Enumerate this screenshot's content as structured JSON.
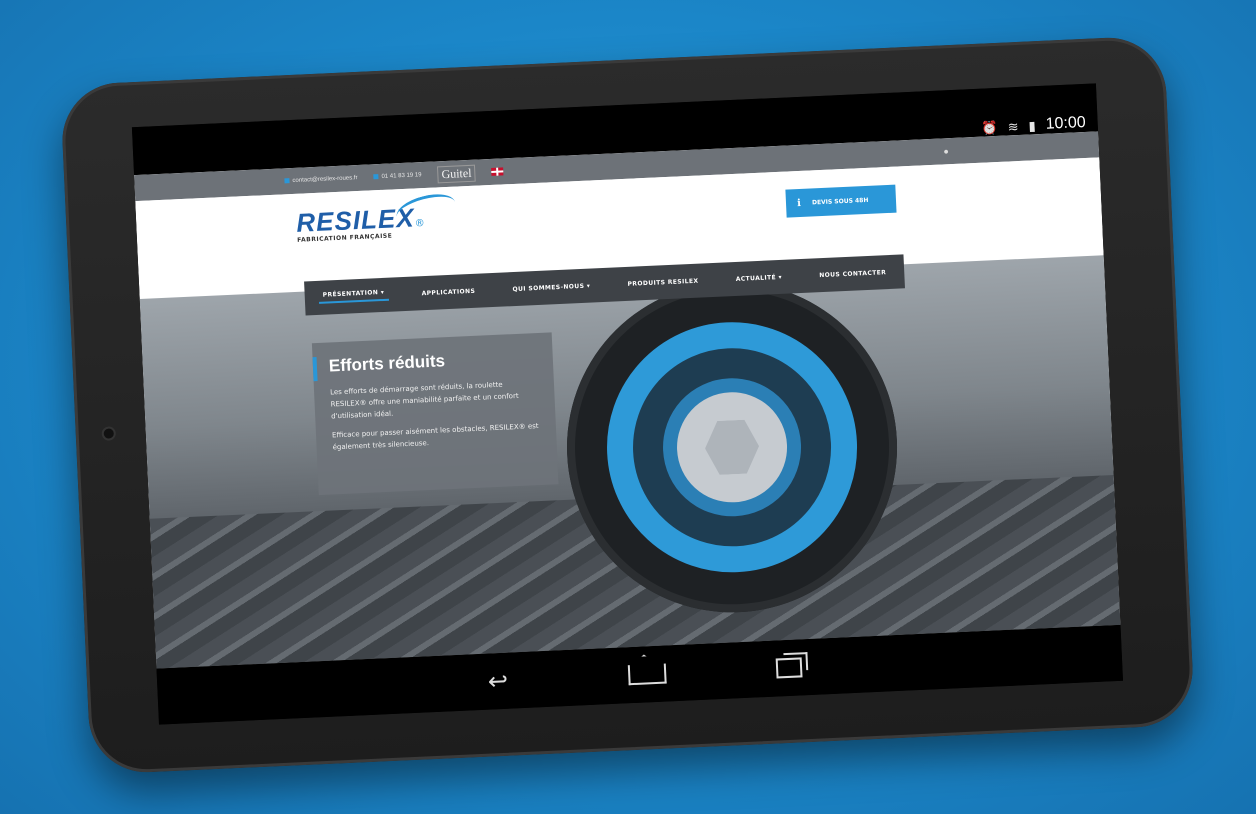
{
  "device": {
    "status": {
      "alarm_icon": "alarm-clock-icon",
      "wifi_icon": "wifi-icon",
      "battery_icon": "battery-icon",
      "time": "10:00"
    },
    "nav_buttons": [
      {
        "icon": "back-icon"
      },
      {
        "icon": "home-icon"
      },
      {
        "icon": "recent-apps-icon"
      }
    ]
  },
  "site": {
    "topbar": {
      "email": "contact@resilex-roues.fr",
      "phone": "01 41 83 19 19",
      "partner": "Guitel",
      "lang_icon": "uk-flag-icon",
      "right_icon": "user-icon"
    },
    "logo": {
      "word": "RESILEX",
      "reg": "®",
      "tagline": "FABRICATION FRANÇAISE"
    },
    "devis_label": "DEVIS SOUS 48H",
    "nav": [
      {
        "label": "PRÉSENTATION",
        "caret": "▾"
      },
      {
        "label": "APPLICATIONS",
        "caret": ""
      },
      {
        "label": "QUI SOMMES-NOUS",
        "caret": "▾"
      },
      {
        "label": "PRODUITS RESILEX",
        "caret": ""
      },
      {
        "label": "ACTUALITÉ",
        "caret": "▾"
      },
      {
        "label": "NOUS CONTACTER",
        "caret": ""
      }
    ],
    "hero": {
      "title": "Efforts réduits",
      "p1": "Les efforts de démarrage sont réduits, la roulette RESILEX® offre une maniabilité parfaite et un confort d'utilisation idéal.",
      "p2": "Efficace pour passer aisément les obstacles, RESILEX® est également très silencieuse."
    }
  },
  "colors": {
    "accent": "#2a97d8",
    "nav_bg": "#3e4247",
    "topbar_bg": "#6d7278",
    "logo": "#1f5ea8"
  }
}
